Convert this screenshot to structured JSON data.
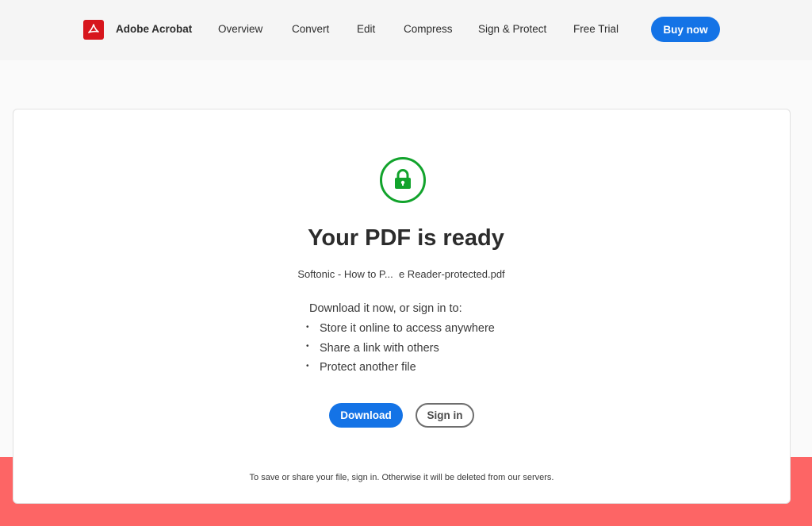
{
  "header": {
    "brand": "Adobe Acrobat",
    "logo_icon": "acrobat-logo-icon",
    "nav": [
      {
        "label": "Overview"
      },
      {
        "label": "Convert"
      },
      {
        "label": "Edit"
      },
      {
        "label": "Compress"
      },
      {
        "label": "Sign & Protect"
      },
      {
        "label": "Free Trial"
      }
    ],
    "buy_label": "Buy now"
  },
  "main": {
    "status_icon": "lock-icon",
    "title": "Your PDF is ready",
    "filename": "Softonic - How to P...  e Reader-protected.pdf",
    "intro": "Download it now, or sign in to:",
    "benefits": [
      "Store it online to access anywhere",
      "Share a link with others",
      "Protect another file"
    ],
    "download_label": "Download",
    "signin_label": "Sign in",
    "footer_note": "To save or share your file, sign in. Otherwise it will be deleted from our servers."
  },
  "colors": {
    "accent": "#1473e6",
    "brand_red": "#d7161d",
    "success_green": "#12a32c",
    "band_red": "#fd6565"
  }
}
